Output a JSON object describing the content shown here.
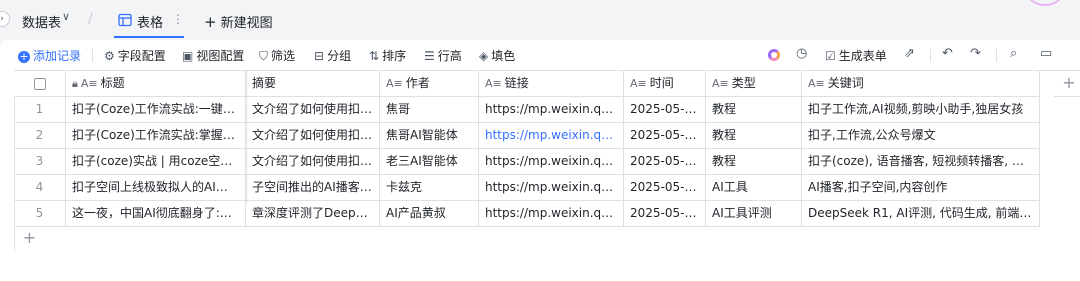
{
  "topbar": {
    "datasheet_label": "数据表",
    "active_tab_label": "表格",
    "new_view_label": "新建视图"
  },
  "toolbar": {
    "add_record": "添加记录",
    "field_config": "字段配置",
    "view_config": "视图配置",
    "filter": "筛选",
    "group": "分组",
    "sort": "排序",
    "row_height": "行高",
    "fill_color": "填色",
    "generate_form": "生成表单"
  },
  "columns": [
    "标题",
    "摘要",
    "作者",
    "链接",
    "时间",
    "类型",
    "关键词"
  ],
  "rows": [
    {
      "num": "1",
      "title": "扣子(Coze)工作流实战:一键AI工...",
      "summary": "文介绍了如何使用扣子...",
      "author": "焦哥",
      "link": "https://mp.weixin.qq.co...",
      "link_highlight": false,
      "date": "2025-05-29",
      "type": "教程",
      "keywords": "扣子工作流,AI视频,剪映小助手,独居女孩"
    },
    {
      "num": "2",
      "title": "扣子(Coze)工作流实战:掌握了这...",
      "summary": "文介绍了如何使用扣子...",
      "author": "焦哥AI智能体",
      "link": "https://mp.weixin.qq.co...",
      "link_highlight": true,
      "date": "2025-05-29",
      "type": "教程",
      "keywords": "扣子,工作流,公众号爆文"
    },
    {
      "num": "3",
      "title": "扣子(coze)实战 | 用coze空间一...",
      "summary": "文介绍了如何使用扣子...",
      "author": "老三AI智能体",
      "link": "https://mp.weixin.qq.co...",
      "link_highlight": false,
      "date": "2025-05-29",
      "type": "教程",
      "keywords": "扣子(coze), 语音播客, 短视频转播客, 文章..."
    },
    {
      "num": "4",
      "title": "扣子空间上线极致拟人的AI播客...",
      "summary": "子空间推出的AI播客功...",
      "author": "卡兹克",
      "link": "https://mp.weixin.qq.co...",
      "link_highlight": false,
      "date": "2025-05-29",
      "type": "AI工具",
      "keywords": "AI播客,扣子空间,内容创作"
    },
    {
      "num": "5",
      "title": "这一夜，中国AI彻底翻身了:Dee...",
      "summary": "章深度评测了DeepSee...",
      "author": "AI产品黄叔",
      "link": "https://mp.weixin.qq.co...",
      "link_highlight": false,
      "date": "2025-05-29",
      "type": "AI工具评测",
      "keywords": "DeepSeek R1, AI评测, 代码生成, 前端设计"
    }
  ]
}
